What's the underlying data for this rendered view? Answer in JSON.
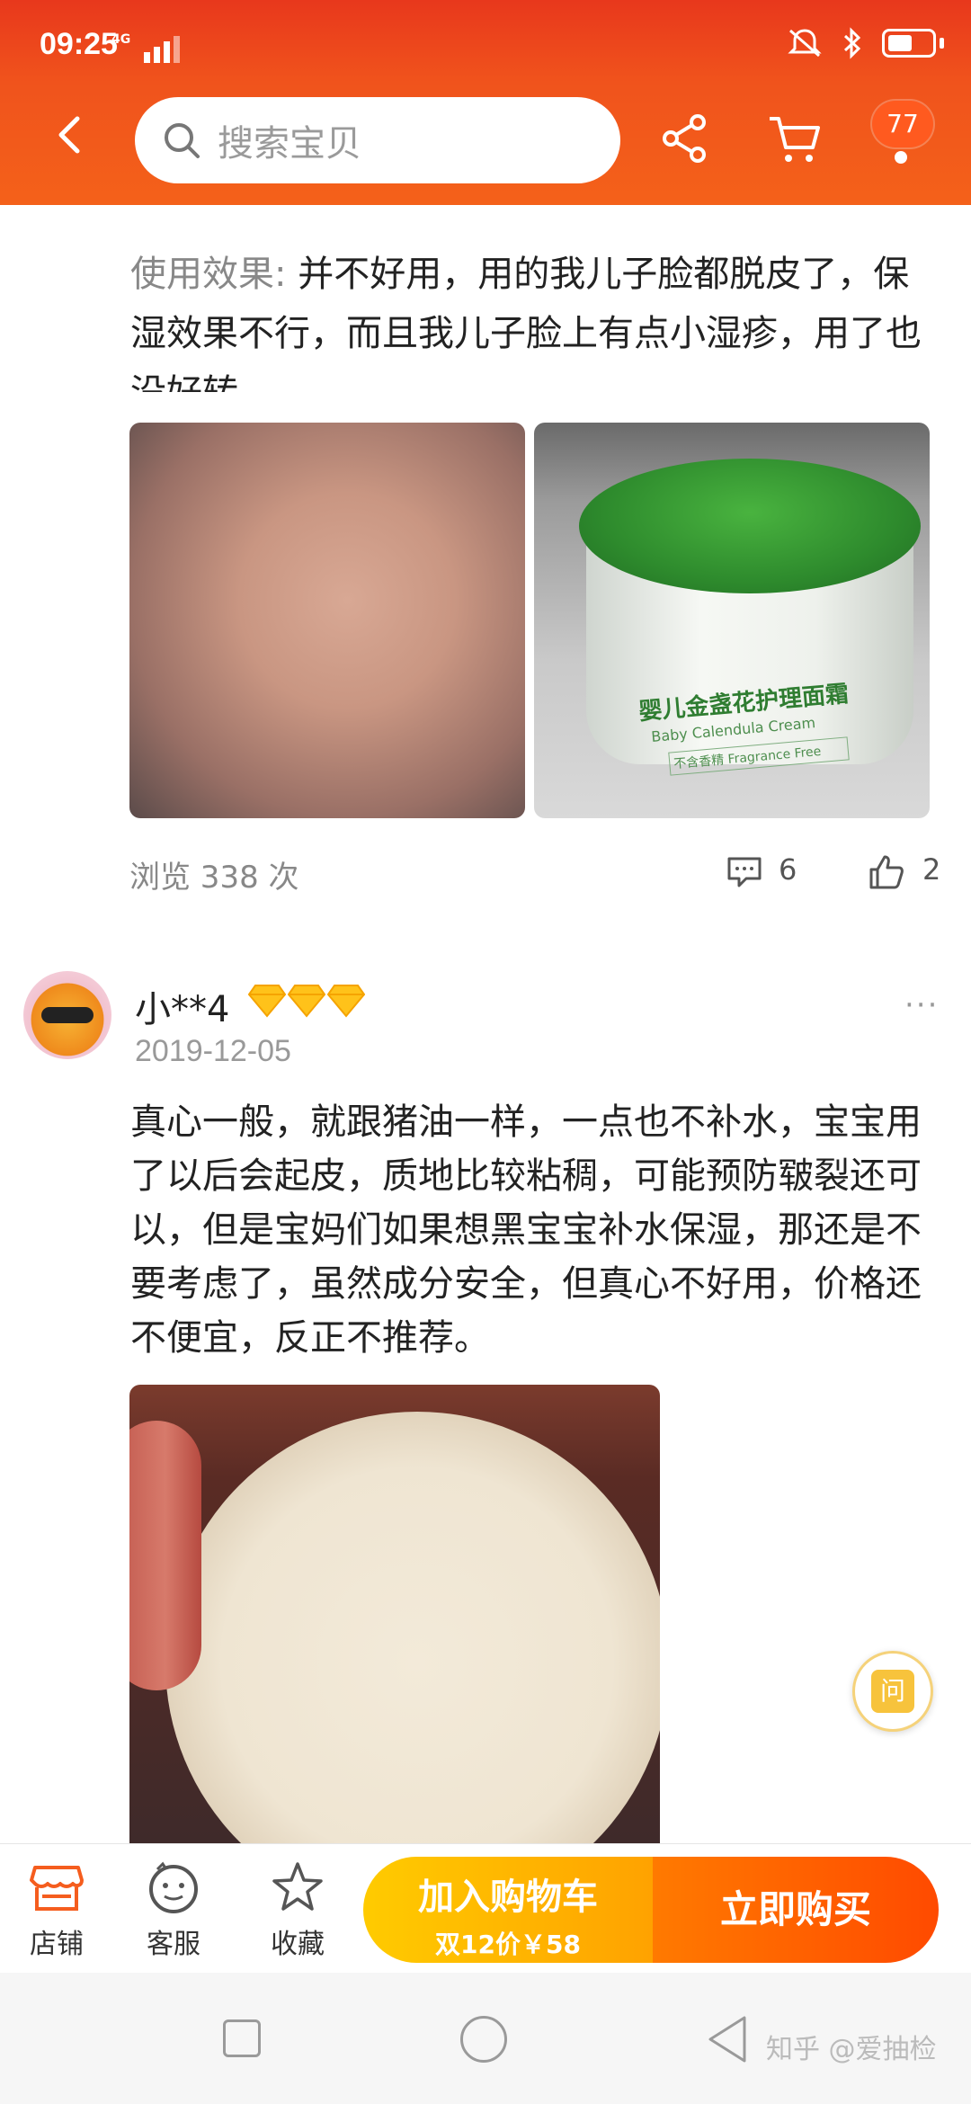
{
  "status": {
    "time": "09:25",
    "network": "4G"
  },
  "header": {
    "search_placeholder": "搜索宝贝",
    "badge_count": "77",
    "accent": "#f0531c"
  },
  "review1": {
    "label": "使用效果:",
    "text": "并不好用，用的我儿子脸都脱皮了，保湿效果不行，而且我儿子脸上有点小湿疹，用了也没好转",
    "product_label_cn": "婴儿金盏花护理面霜",
    "product_label_en": "Baby Calendula Cream",
    "product_label_ff": "不含香精 Fragrance Free",
    "views": "浏览 338 次",
    "comments": "6",
    "likes": "2"
  },
  "review2": {
    "username": "小**4",
    "date": "2019-12-05",
    "more": "···",
    "text": "真心一般，就跟猪油一样，一点也不补水，宝宝用了以后会起皮，质地比较粘稠，可能预防皲裂还可以，但是宝妈们如果想黑宝宝补水保湿，那还是不要考虑了，虽然成分安全，但真心不好用，价格还不便宜，反正不推荐。"
  },
  "ask_button": "问",
  "action_bar": {
    "shop": "店铺",
    "service": "客服",
    "favorite": "收藏",
    "add_cart": "加入购物车",
    "add_cart_sub": "双12价￥58",
    "buy_now": "立即购买"
  },
  "watermark": "知乎 @爱抽检"
}
